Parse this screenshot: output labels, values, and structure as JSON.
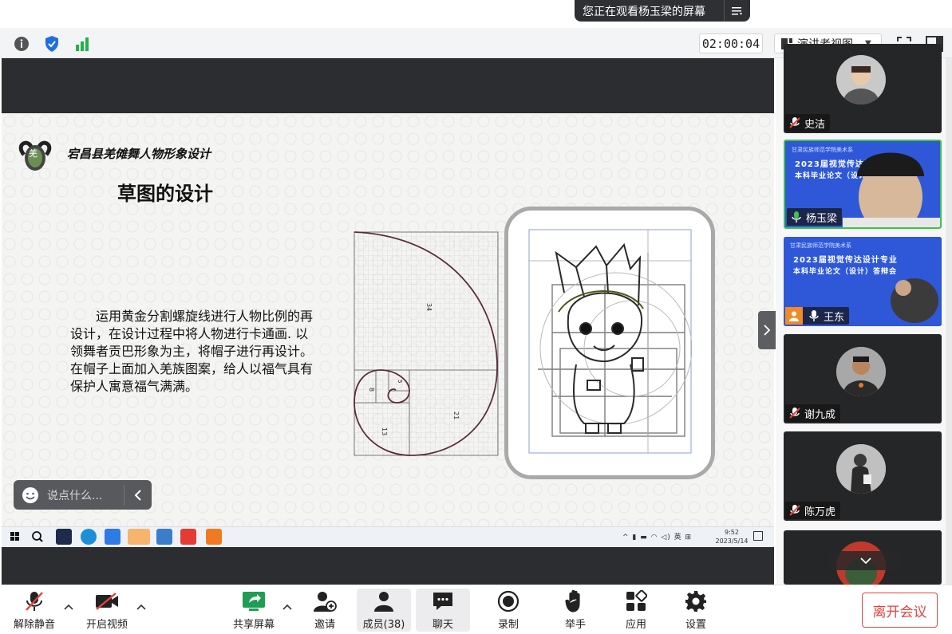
{
  "banner": {
    "text": "您正在观看杨玉梁的屏幕",
    "menu_icon": "list-menu-icon"
  },
  "toolbar": {
    "timer": "02:00:04",
    "view_mode": "演讲者视图",
    "icons": [
      "info-icon",
      "shield-icon",
      "signal-icon",
      "fullscreen-icon",
      "sidebar-icon"
    ]
  },
  "slide": {
    "header": "宕昌县羌傩舞人物形象设计",
    "logo_text": "羌",
    "title": "草图的设计",
    "body": "运用黄金分割螺旋线进行人物比例的再设计，在设计过程中将人物进行卡通画. 以领舞者贡巴形象为主，将帽子进行再设计。在帽子上面加入羌族图案，给人以福气具有保护人寓意福气满满。",
    "spiral_labels": [
      "34",
      "8",
      "5",
      "21",
      "13"
    ]
  },
  "chat": {
    "placeholder": "说点什么..."
  },
  "taskbar": {
    "tray_icons": "^ ▮ ▬ ◠ ◁) 英 ⊞",
    "time": "9:52",
    "date": "2023/5/14"
  },
  "participants": [
    {
      "name": "史洁",
      "mic": "muted",
      "type": "avatar"
    },
    {
      "name": "杨玉梁",
      "mic": "active",
      "type": "screen",
      "screen_line1": "甘肃民族师范学院美术系",
      "screen_line2": "2023届视觉传达设计专业",
      "screen_line3": "本科毕业论文（设计）答辩会"
    },
    {
      "name": "王东",
      "mic": "on",
      "type": "screen",
      "screen_line1": "甘肃民族师范学院美术系",
      "screen_line2": "2023届视觉传达设计专业",
      "screen_line3": "本科毕业论文（设计）答辩会"
    },
    {
      "name": "谢九成",
      "mic": "muted",
      "type": "avatar"
    },
    {
      "name": "陈万虎",
      "mic": "muted",
      "type": "avatar"
    }
  ],
  "controls": {
    "unmute": "解除静音",
    "video": "开启视频",
    "share": "共享屏幕",
    "invite": "邀请",
    "members": "成员(38)",
    "chat": "聊天",
    "record": "录制",
    "raise_hand": "举手",
    "apps": "应用",
    "settings": "设置",
    "leave": "离开会议"
  },
  "colors": {
    "accent_green": "#3fc24b",
    "leave_red": "#e0443e",
    "share_green": "#1f9d55",
    "tile_blue": "#2f58d8"
  }
}
